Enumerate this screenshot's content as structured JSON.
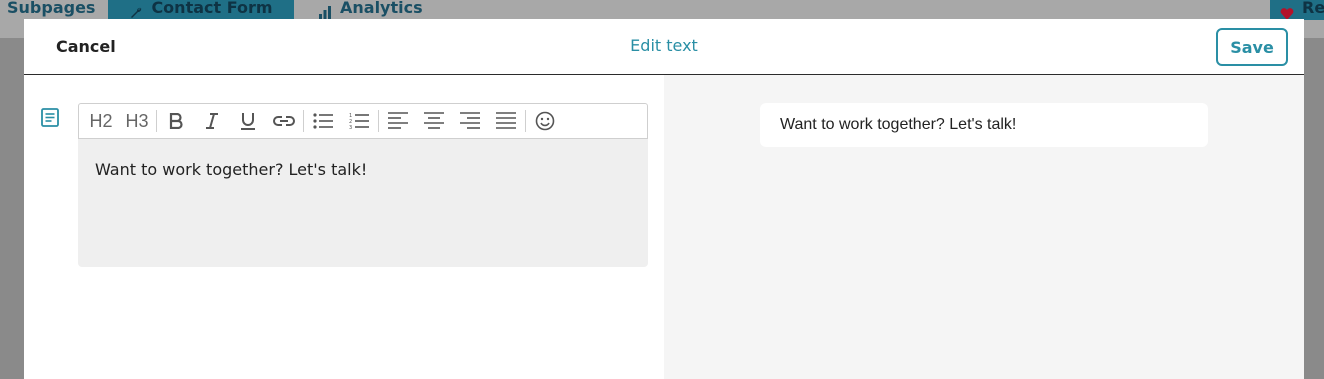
{
  "background_nav": {
    "subpages": "Subpages",
    "contact_form": "Contact Form",
    "analytics": "Analytics",
    "re": "Re"
  },
  "header": {
    "cancel_label": "Cancel",
    "title": "Edit text",
    "save_label": "Save"
  },
  "toolbar": {
    "h2": "H2",
    "h3": "H3",
    "icons": [
      "bold-icon",
      "italic-icon",
      "underline-icon",
      "link-icon",
      "bullet-list-icon",
      "numbered-list-icon",
      "align-left-icon",
      "align-center-icon",
      "align-right-icon",
      "align-justify-icon",
      "emoji-icon"
    ]
  },
  "editor": {
    "content": "Want to work together? Let's talk!"
  },
  "preview": {
    "content": "Want to work together? Let's talk!"
  },
  "colors": {
    "accent": "#2a8fa5",
    "editor_bg": "#efefef",
    "preview_bg": "#f5f5f5",
    "overlay": "#8a8a8a"
  }
}
